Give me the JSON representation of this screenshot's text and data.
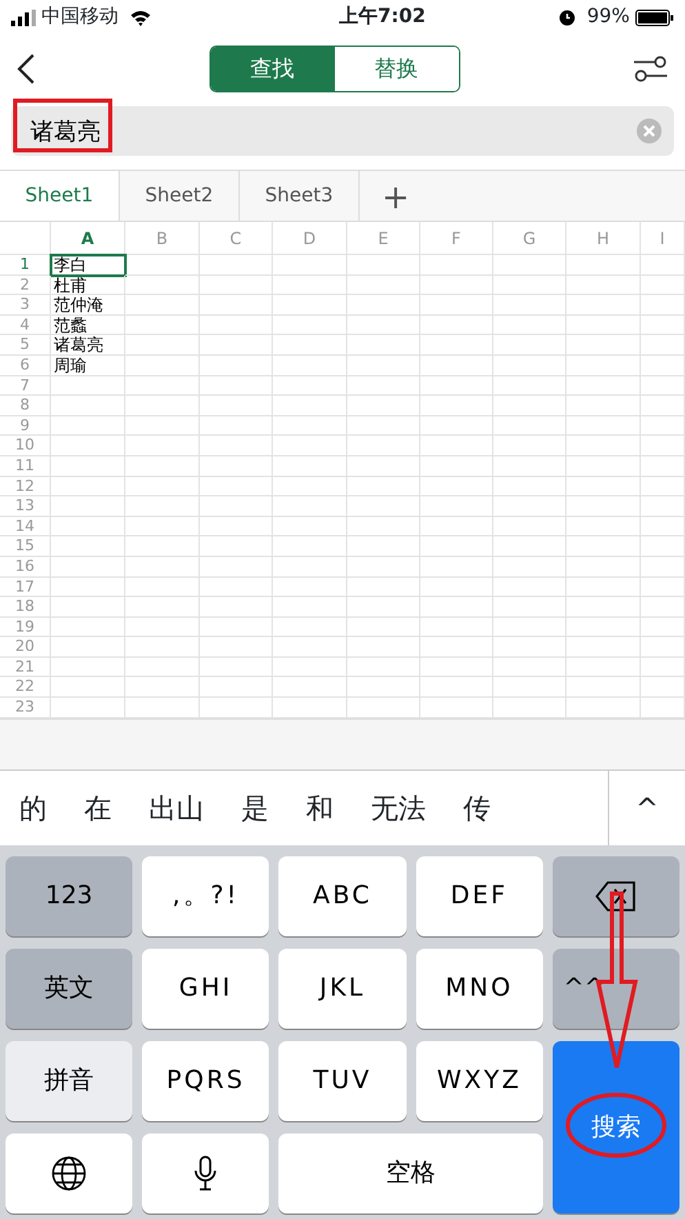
{
  "status_bar": {
    "carrier": "中国移动",
    "time": "上午7:02",
    "battery": "99%"
  },
  "toolbar": {
    "segments": [
      {
        "label": "查找",
        "selected": true
      },
      {
        "label": "替换",
        "selected": false
      }
    ]
  },
  "search": {
    "value": "诸葛亮"
  },
  "sheet_tabs": [
    {
      "label": "Sheet1",
      "selected": true
    },
    {
      "label": "Sheet2",
      "selected": false
    },
    {
      "label": "Sheet3",
      "selected": false
    }
  ],
  "add_sheet": "+",
  "grid": {
    "columns": [
      {
        "label": "A",
        "selected": true
      },
      {
        "label": "B",
        "selected": false
      },
      {
        "label": "C",
        "selected": false
      },
      {
        "label": "D",
        "selected": false
      },
      {
        "label": "E",
        "selected": false
      },
      {
        "label": "F",
        "selected": false
      },
      {
        "label": "G",
        "selected": false
      },
      {
        "label": "H",
        "selected": false
      },
      {
        "label": "I",
        "selected": false
      }
    ],
    "rows": [
      {
        "number": "1",
        "cells": [
          "李白"
        ],
        "selected": true
      },
      {
        "number": "2",
        "cells": [
          "杜甫"
        ],
        "selected": false
      },
      {
        "number": "3",
        "cells": [
          "范仲淹"
        ],
        "selected": false
      },
      {
        "number": "4",
        "cells": [
          "范蠡"
        ],
        "selected": false
      },
      {
        "number": "5",
        "cells": [
          "诸葛亮"
        ],
        "selected": false
      },
      {
        "number": "6",
        "cells": [
          "周瑜"
        ],
        "selected": false
      },
      {
        "number": "7",
        "cells": [],
        "selected": false
      },
      {
        "number": "8",
        "cells": [],
        "selected": false
      },
      {
        "number": "9",
        "cells": [],
        "selected": false
      },
      {
        "number": "10",
        "cells": [],
        "selected": false
      },
      {
        "number": "11",
        "cells": [],
        "selected": false
      },
      {
        "number": "12",
        "cells": [],
        "selected": false
      },
      {
        "number": "13",
        "cells": [],
        "selected": false
      },
      {
        "number": "14",
        "cells": [],
        "selected": false
      },
      {
        "number": "15",
        "cells": [],
        "selected": false
      },
      {
        "number": "16",
        "cells": [],
        "selected": false
      },
      {
        "number": "17",
        "cells": [],
        "selected": false
      },
      {
        "number": "18",
        "cells": [],
        "selected": false
      },
      {
        "number": "19",
        "cells": [],
        "selected": false
      },
      {
        "number": "20",
        "cells": [],
        "selected": false
      },
      {
        "number": "21",
        "cells": [],
        "selected": false
      },
      {
        "number": "22",
        "cells": [],
        "selected": false
      },
      {
        "number": "23",
        "cells": [],
        "selected": false
      }
    ]
  },
  "candidates": [
    "的",
    "在",
    "出山",
    "是",
    "和",
    "无法",
    "传"
  ],
  "candidate_toggle": "^",
  "keyboard": [
    {
      "label": "123",
      "kind": "function"
    },
    {
      "label": ",。?!",
      "kind": "letter"
    },
    {
      "label": "ABC",
      "kind": "letter"
    },
    {
      "label": "DEF",
      "kind": "letter"
    },
    {
      "kind": "delete"
    },
    {
      "label": "英文",
      "kind": "function"
    },
    {
      "label": "GHI",
      "kind": "letter"
    },
    {
      "label": "JKL",
      "kind": "letter"
    },
    {
      "label": "MNO",
      "kind": "letter"
    },
    {
      "label": "^^",
      "kind": "shifted"
    },
    {
      "label": "拼音",
      "kind": "light"
    },
    {
      "label": "PQRS",
      "kind": "letter"
    },
    {
      "label": "TUV",
      "kind": "letter"
    },
    {
      "label": "WXYZ",
      "kind": "letter"
    },
    {
      "label": "搜索",
      "kind": "action"
    },
    {
      "kind": "globe"
    },
    {
      "kind": "mic"
    },
    {
      "label": "空格",
      "kind": "space"
    }
  ],
  "annotations": [
    {
      "kind": "box"
    },
    {
      "kind": "arrow"
    },
    {
      "kind": "ellipse"
    }
  ]
}
